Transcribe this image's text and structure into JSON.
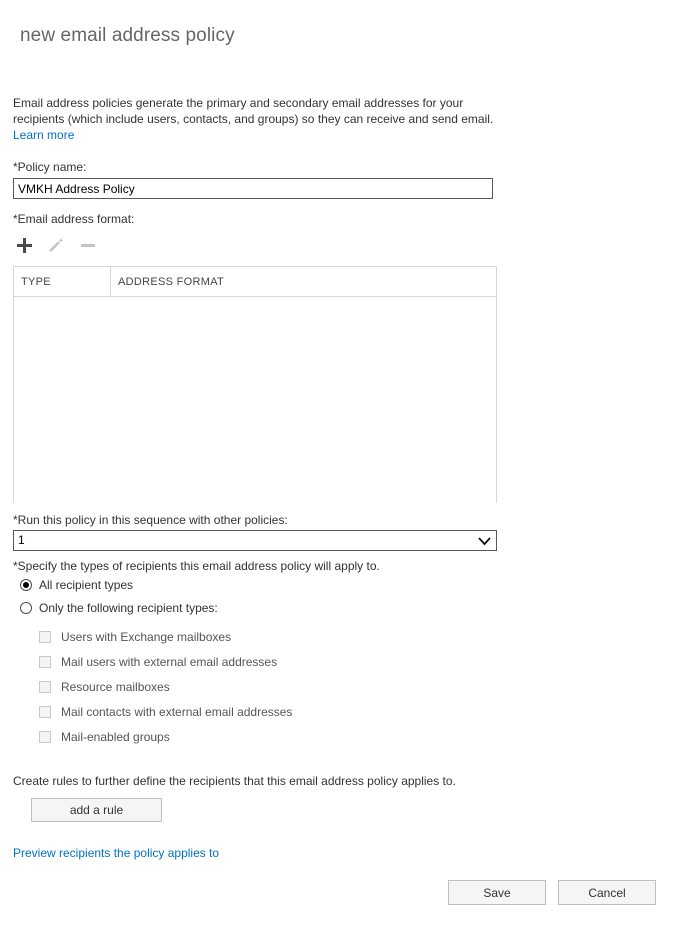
{
  "page": {
    "title": "new email address policy",
    "intro": {
      "line1": "Email address policies generate the primary and secondary email addresses for your",
      "line2": "recipients (which include users, contacts, and groups) so they can receive and send email.",
      "learn_more": "Learn more"
    }
  },
  "policy_name": {
    "label": "*Policy name:",
    "value": "VMKH Address Policy",
    "placeholder": ""
  },
  "email_format": {
    "label": "*Email address format:",
    "toolbar": {
      "add": "add-icon",
      "edit": "edit-icon",
      "remove": "remove-icon"
    },
    "table": {
      "columns": [
        "TYPE",
        "ADDRESS FORMAT"
      ],
      "rows": []
    }
  },
  "sequence": {
    "label": "*Run this policy in this sequence with other policies:",
    "selected": "1",
    "options": [
      "1"
    ]
  },
  "recipient_types": {
    "label": "*Specify the types of recipients this email address policy will apply to.",
    "radios": [
      {
        "label": "All recipient types",
        "checked": true
      },
      {
        "label": "Only the following recipient types:",
        "checked": false
      }
    ],
    "checkboxes": [
      {
        "label": "Users with Exchange mailboxes",
        "checked": false
      },
      {
        "label": "Mail users with external email addresses",
        "checked": false
      },
      {
        "label": "Resource mailboxes",
        "checked": false
      },
      {
        "label": "Mail contacts with external email addresses",
        "checked": false
      },
      {
        "label": "Mail-enabled groups",
        "checked": false
      }
    ]
  },
  "rules": {
    "description": "Create rules to further define the recipients that this email address policy applies to.",
    "add_rule_label": "add a rule",
    "preview_link": "Preview recipients the policy applies to"
  },
  "footer": {
    "save_label": "Save",
    "cancel_label": "Cancel"
  },
  "colors": {
    "link": "#0072c6",
    "title": "#666666",
    "text": "#333333",
    "border": "#595959",
    "grid_border": "#d6d6d6",
    "button_bg": "#f5f5f5"
  }
}
